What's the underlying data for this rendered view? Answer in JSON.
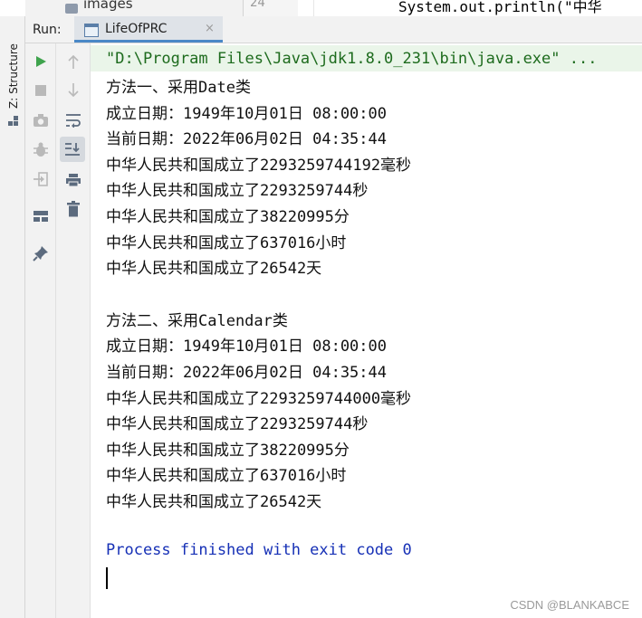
{
  "editor_strip": {
    "project_item": "images",
    "line_number": "24",
    "code_fragment": "System.out.println(\"中华"
  },
  "left_tool_window": {
    "structure_label": "Z: Structure"
  },
  "run_panel": {
    "run_label": "Run:",
    "tab_label": "LifeOfPRC",
    "tab_close": "×"
  },
  "toolbar_col1": [
    "run-icon",
    "stop-icon",
    "camera-icon",
    "bug-icon",
    "login-icon",
    "layout-icon",
    "pin-icon"
  ],
  "toolbar_col2": [
    "arrow-up-icon",
    "arrow-down-icon",
    "soft-wrap-icon",
    "scroll-to-end-icon",
    "print-icon",
    "trash-icon"
  ],
  "console": {
    "command": "\"D:\\Program Files\\Java\\jdk1.8.0_231\\bin\\java.exe\" ...",
    "lines": [
      "方法一、采用Date类",
      "成立日期：1949年10月01日 08:00:00",
      "当前日期：2022年06月02日 04:35:44",
      "中华人民共和国成立了2293259744192毫秒",
      "中华人民共和国成立了2293259744秒",
      "中华人民共和国成立了38220995分",
      "中华人民共和国成立了637016小时",
      "中华人民共和国成立了26542天",
      "",
      "方法二、采用Calendar类",
      "成立日期：1949年10月01日 08:00:00",
      "当前日期：2022年06月02日 04:35:44",
      "中华人民共和国成立了2293259744000毫秒",
      "中华人民共和国成立了2293259744秒",
      "中华人民共和国成立了38220995分",
      "中华人民共和国成立了637016小时",
      "中华人民共和国成立了26542天",
      "",
      "Process finished with exit code 0"
    ]
  },
  "watermark": "CSDN @BLANKABCE",
  "colors": {
    "panel_bg": "#f2f2f2",
    "command_bg": "#eaf5e9",
    "command_text": "#1d6b1d",
    "finish_text": "#1630b6",
    "run_green": "#3fa34d",
    "tab_underline": "#4a88c7"
  }
}
